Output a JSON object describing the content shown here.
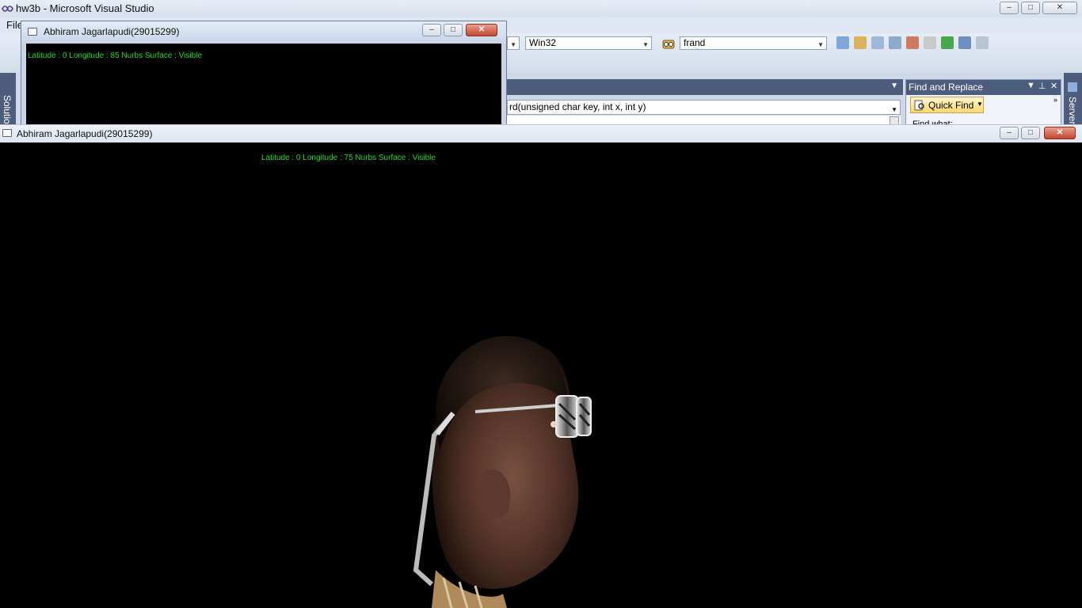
{
  "vs": {
    "title": "hw3b - Microsoft Visual Studio",
    "menu_first": "File",
    "platform_combo": "Win32",
    "find_combo": "frand",
    "function_combo": "rd(unsigned char key, int x, int y)",
    "find_replace": {
      "title": "Find and Replace",
      "quick_find": "Quick Find",
      "find_what_label": "Find what:"
    },
    "left_tab": "Solution",
    "right_tab": "Server"
  },
  "small_window": {
    "title": "Abhiram Jagarlapudi(29015299)",
    "status": "Latitude : 0 Longitude : 85 Nurbs Surface : Visible"
  },
  "big_window": {
    "title": "Abhiram Jagarlapudi(29015299)",
    "status": "Latitude : 0 Longitude : 75 Nurbs Surface : Visible"
  },
  "window_buttons": {
    "minimize": "–",
    "maximize": "□",
    "close": "✕"
  },
  "colors": {
    "status_text": "#1fdc2a",
    "vs_chrome": "#4c5d7e"
  },
  "icons": [
    "vs-logo-icon",
    "app-window-icon",
    "binoculars-icon",
    "dropdown-arrow-icon"
  ]
}
